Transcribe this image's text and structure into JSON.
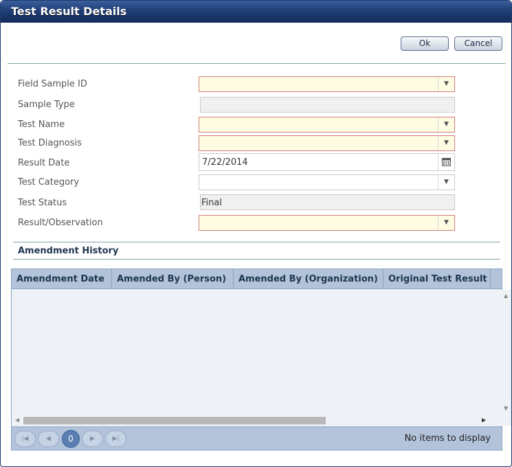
{
  "dialog": {
    "title": "Test Result Details"
  },
  "toolbar": {
    "ok_label": "Ok",
    "cancel_label": "Cancel"
  },
  "form": {
    "field_sample_id": {
      "label": "Field Sample ID",
      "value": ""
    },
    "sample_type": {
      "label": "Sample Type",
      "value": ""
    },
    "test_name": {
      "label": "Test Name",
      "value": ""
    },
    "test_diagnosis": {
      "label": "Test Diagnosis",
      "value": ""
    },
    "result_date": {
      "label": "Result Date",
      "value": "7/22/2014"
    },
    "test_category": {
      "label": "Test Category",
      "value": ""
    },
    "test_status": {
      "label": "Test Status",
      "value": "Final"
    },
    "result_observation": {
      "label": "Result/Observation",
      "value": ""
    }
  },
  "amendment_history": {
    "title": "Amendment History",
    "columns": [
      "Amendment Date",
      "Amended By (Person)",
      "Amended By (Organization)",
      "Original Test Result"
    ],
    "rows": [],
    "pager": {
      "current_page": "0",
      "info": "No items to display"
    }
  },
  "icons": {
    "dropdown": "triangle-down-icon",
    "calendar": "calendar-icon",
    "first": "first-page-icon",
    "prev": "prev-page-icon",
    "next": "next-page-icon",
    "last": "last-page-icon"
  },
  "colors": {
    "title_bar": "#203f78",
    "required_bg": "#fefde3",
    "required_border": "#d27a7a",
    "grid_header": "#b2c3da",
    "grid_body": "#eef1f6"
  }
}
